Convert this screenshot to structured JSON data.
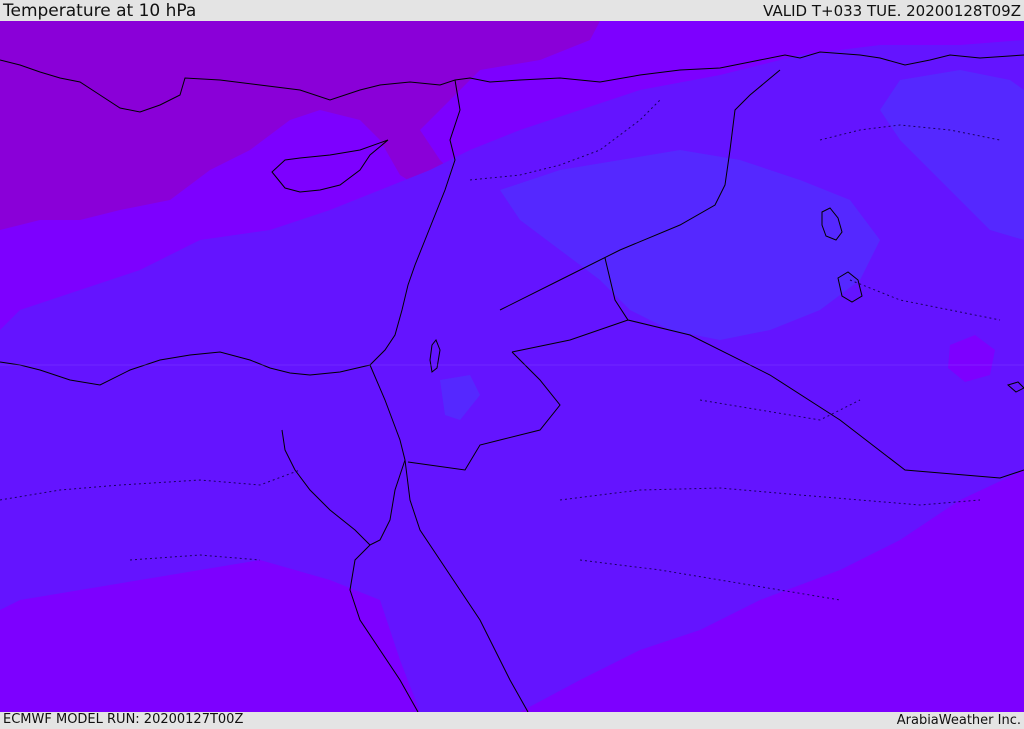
{
  "header": {
    "title": "Temperature at 10 hPa",
    "valid": "VALID T+033 TUE. 20200128T09Z"
  },
  "footer": {
    "model_run": "ECMWF MODEL RUN: 20200127T00Z",
    "credit": "ArabiaWeather Inc."
  },
  "colors": {
    "band_warm": "#8a00d8",
    "band_mid": "#7d00ff",
    "band_cool": "#6414ff",
    "band_cold": "#5528ff",
    "coast": "#000000"
  }
}
